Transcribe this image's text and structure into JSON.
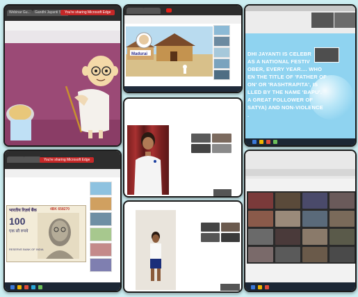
{
  "screenshots": {
    "top_left": {
      "banner": "You're sharing Microsoft Edge",
      "tabs": [
        "Webinar Gu...",
        "Gandhi Jayanti Sp..."
      ]
    },
    "top_middle": {
      "video_caption": "Madurai"
    },
    "top_right": {
      "slide_lines": [
        "DHI JAYANTI IS CELEBR",
        "AS A NATIONAL FESTIV",
        "OBER, EVERY YEAR.... WHO",
        "EN THE TITLE OF 'FATHER OF",
        "ON' OR 'RASHTRAPITA', IS",
        "LLED BY THE NAME 'BAPU'.",
        "A GREAT FOLLOWER OF",
        "SATYA) AND NON-VIOLENCE",
        "."
      ]
    },
    "bottom_left": {
      "banner": "You're sharing Microsoft Edge",
      "note_header": "भारतीय रिज़र्व बैंक",
      "note_header_en": "RESERVE BANK OF INDIA",
      "note_denomination": "100",
      "note_serial": "4BK 658270",
      "note_words": "एक सौ रुपये"
    }
  },
  "colors": {
    "background": "#cdeef2",
    "banner_red": "#c62828",
    "slide_blue": "#8fd3f0",
    "cartoon_wall": "#9b4a76"
  }
}
